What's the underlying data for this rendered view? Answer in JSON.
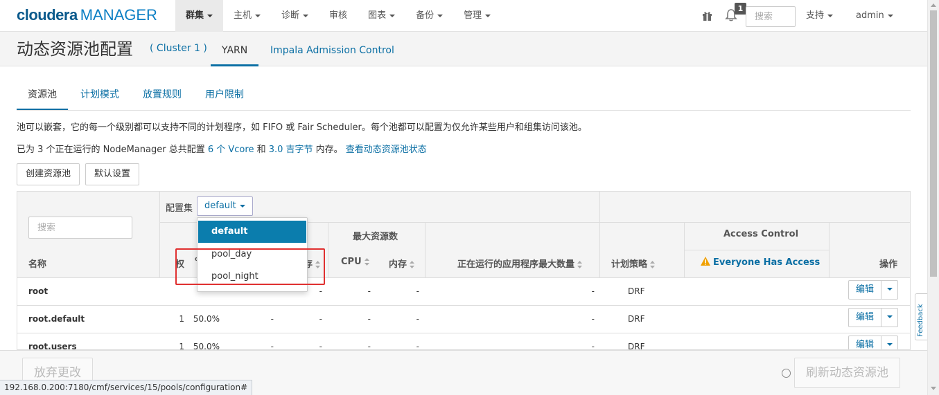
{
  "brand": {
    "name_part1": "cloudera",
    "name_part2": "MANAGER"
  },
  "nav": {
    "items": [
      {
        "label": "群集",
        "active": true
      },
      {
        "label": "主机"
      },
      {
        "label": "诊断"
      },
      {
        "label": "审核"
      },
      {
        "label": "图表"
      },
      {
        "label": "备份"
      },
      {
        "label": "管理"
      }
    ],
    "notification_count": "1",
    "search_placeholder": "搜索",
    "support_label": "支持",
    "user_label": "admin"
  },
  "page": {
    "title": "动态资源池配置",
    "cluster_link": "( Cluster 1 )",
    "tabs": [
      {
        "label": "YARN",
        "active": true
      },
      {
        "label": "Impala Admission Control"
      }
    ]
  },
  "subtabs": [
    {
      "label": "资源池",
      "active": true
    },
    {
      "label": "计划模式"
    },
    {
      "label": "放置规则"
    },
    {
      "label": "用户限制"
    }
  ],
  "info": {
    "line1": "池可以嵌套，它的每一个级别都可以支持不同的计划程序，如 FIFO 或 Fair Scheduler。每个池都可以配置为仅允许某些用户和组集访问该池。",
    "line2_prefix": "已为 3 个正在运行的 NodeManager 总共配置 ",
    "line2_vcore": "6 个 Vcore",
    "line2_and": " 和 ",
    "line2_mem": "3.0 吉字节",
    "line2_mid": " 内存。 ",
    "line2_link": "查看动态资源池状态"
  },
  "buttons": {
    "create_pool": "创建资源池",
    "default_settings": "默认设置"
  },
  "table": {
    "search_placeholder": "搜索",
    "config_set_label": "配置集",
    "config_set_value": "default",
    "headers": {
      "name": "名称",
      "weight": "权",
      "weight_pct": "%",
      "mem_partial": "存",
      "max_resources": "最大资源数",
      "cpu": "CPU",
      "memory": "内存",
      "max_running_apps": "正在运行的应用程序最大数量",
      "scheduling_policy": "计划策略",
      "access_control": "Access Control",
      "everyone_access": "Everyone Has Access",
      "actions": "操作"
    },
    "rows": [
      {
        "name": "root",
        "weight": "",
        "pct": "",
        "min_cpu": "-",
        "min_mem": "-",
        "max_cpu": "-",
        "max_mem": "-",
        "max_apps": "-",
        "policy": "DRF",
        "edit": "编辑"
      },
      {
        "name": "root.default",
        "weight": "1",
        "pct": "50.0%",
        "min_cpu": "-",
        "min_mem": "-",
        "max_cpu": "-",
        "max_mem": "-",
        "max_apps": "-",
        "policy": "DRF",
        "edit": "编辑"
      },
      {
        "name": "root.users",
        "weight": "1",
        "pct": "50.0%",
        "min_cpu": "-",
        "min_mem": "-",
        "max_cpu": "-",
        "max_mem": "-",
        "max_apps": "-",
        "policy": "DRF",
        "edit": "编辑"
      }
    ]
  },
  "dropdown": {
    "options": [
      {
        "label": "default",
        "selected": true
      },
      {
        "label": "pool_day"
      },
      {
        "label": "pool_night"
      }
    ]
  },
  "footer": {
    "discard": "放弃更改",
    "refresh": "刷新动态资源池"
  },
  "status_url": "192.168.0.200:7180/cmf/services/15/pools/configuration#",
  "feedback_label": "Feedback",
  "colors": {
    "link": "#0b6fa4",
    "dropdown_active": "#0b7dad",
    "highlight_box": "#e03030",
    "warning": "#f0a000"
  }
}
